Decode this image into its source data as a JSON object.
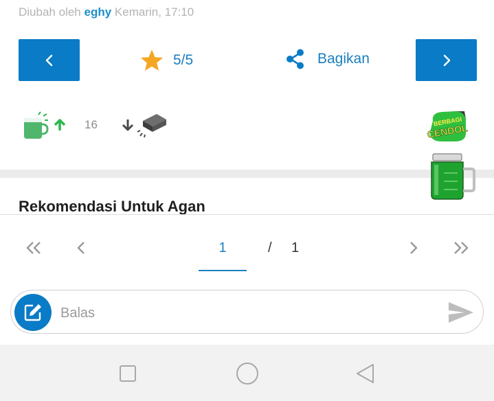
{
  "meta": {
    "edited_prefix": "Diubah oleh",
    "editor": "eghy",
    "edited_time": "Kemarin, 17:10"
  },
  "nav": {
    "rating": "5/5",
    "share_label": "Bagikan"
  },
  "cendol": {
    "count": "16",
    "badge_line1": "BERBAGI",
    "badge_line2": "CENDOL"
  },
  "section": {
    "title": "Rekomendasi Untuk Agan"
  },
  "pagination": {
    "current": "1",
    "separator": "/",
    "total": "1"
  },
  "reply": {
    "placeholder": "Balas"
  },
  "colors": {
    "primary": "#0a7bc6",
    "link": "#1a7fbf",
    "star": "#f5a623",
    "cendol_green": "#2db84d"
  }
}
